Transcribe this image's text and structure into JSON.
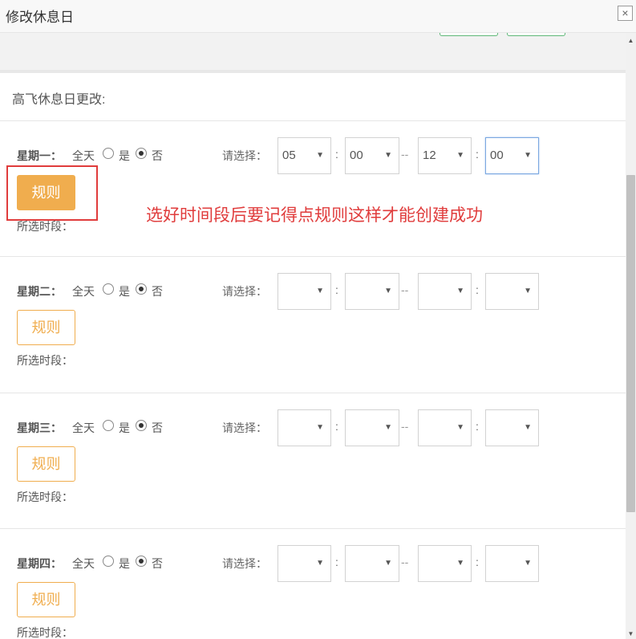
{
  "dialog": {
    "title": "修改休息日",
    "close_icon": "×"
  },
  "section": {
    "title": "高飞休息日更改:"
  },
  "labels": {
    "all_day": "全天",
    "yes": "是",
    "no": "否",
    "please_choose": "请选择：",
    "colon": ":",
    "dash": "--",
    "rule_button": "规则",
    "selected_periods": "所选时段："
  },
  "days": [
    {
      "label": "星期一：",
      "all_day": false,
      "start_hour": "05",
      "start_min": "00",
      "end_hour": "12",
      "end_min": "00"
    },
    {
      "label": "星期二：",
      "all_day": false,
      "start_hour": "",
      "start_min": "",
      "end_hour": "",
      "end_min": ""
    },
    {
      "label": "星期三：",
      "all_day": false,
      "start_hour": "",
      "start_min": "",
      "end_hour": "",
      "end_min": ""
    },
    {
      "label": "星期四：",
      "all_day": false,
      "start_hour": "",
      "start_min": "",
      "end_hour": "",
      "end_min": ""
    }
  ],
  "annotation": {
    "text": "选好时间段后要记得点规则这样才能创建成功",
    "color": "#e03c3c"
  },
  "colors": {
    "accent_orange": "#f0ad4e",
    "focus_blue": "#7aa7e0"
  }
}
